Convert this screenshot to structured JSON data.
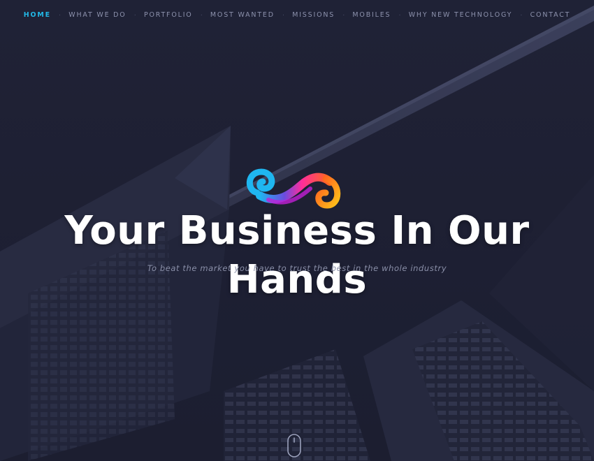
{
  "nav": {
    "items": [
      {
        "label": "HOME",
        "active": true
      },
      {
        "label": "WHAT WE DO",
        "active": false
      },
      {
        "label": "PORTFOLIO",
        "active": false
      },
      {
        "label": "MOST WANTED",
        "active": false
      },
      {
        "label": "MISSIONS",
        "active": false
      },
      {
        "label": "MOBILES",
        "active": false
      },
      {
        "label": "WHY NEW TECHNOLOGY",
        "active": false
      },
      {
        "label": "CONTACT",
        "active": false
      }
    ],
    "separator": "·"
  },
  "hero": {
    "title": "Your Business In Our Hands",
    "subtitle": "To beat the market you have to trust the best in the whole industry"
  },
  "icons": {
    "logo": "swirl-logo-icon",
    "scroll": "mouse-scroll-icon"
  },
  "colors": {
    "background": "#1f2236",
    "nav_text": "#8d92ad",
    "nav_active": "#22b8e6",
    "title": "#ffffff",
    "subtitle": "#8a8fa8"
  }
}
